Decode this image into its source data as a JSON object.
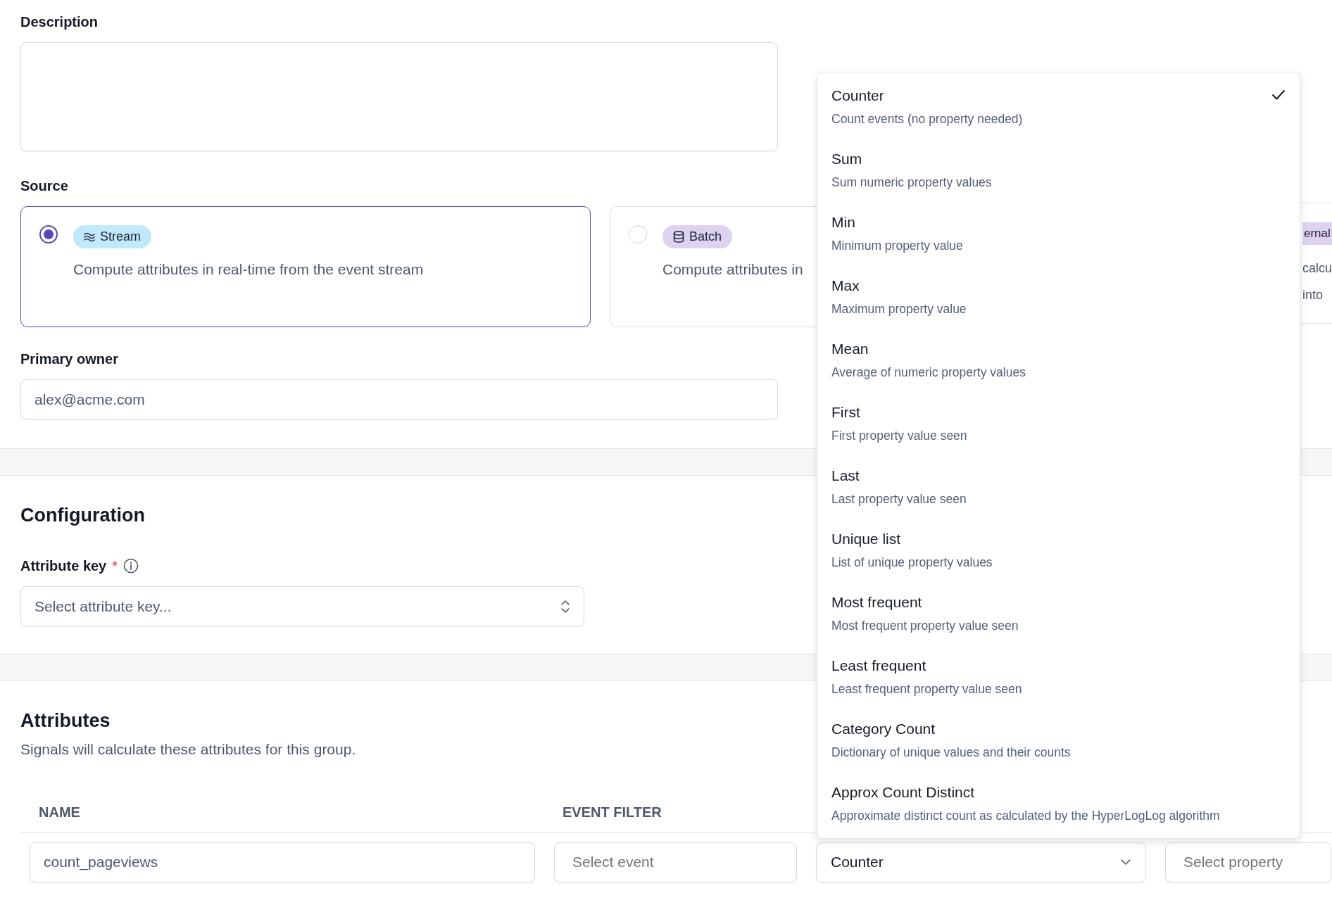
{
  "description": {
    "label": "Description"
  },
  "source": {
    "label": "Source",
    "options": [
      {
        "kind": "full",
        "badge": "Stream",
        "color": "#c1e8fb",
        "selected": true,
        "description": [
          "Compute attributes in real-time from the event stream"
        ]
      },
      {
        "kind": "full",
        "badge": "Batch",
        "color": "#ddd3f0",
        "selected": false,
        "description": [
          "Compute attributes in"
        ]
      },
      {
        "kind": "clipped",
        "badge": "ernal",
        "color": "#ddd3f0",
        "description": [
          "calcu",
          "into"
        ]
      }
    ]
  },
  "primary_owner": {
    "label": "Primary owner",
    "value": "alex@acme.com"
  },
  "configuration": {
    "heading": "Configuration",
    "attribute_key": {
      "label": "Attribute key",
      "required": "*",
      "placeholder": "Select attribute key..."
    }
  },
  "attributes": {
    "heading": "Attributes",
    "subtitle": "Signals will calculate these attributes for this group.",
    "columns": [
      "NAME",
      "EVENT FILTER"
    ],
    "rows": [
      {
        "name": "count_pageviews",
        "event_filter_placeholder": "Select event",
        "aggregation": "Counter",
        "property_placeholder": "Select property"
      }
    ]
  },
  "aggregation_menu": {
    "options": [
      {
        "label": "Counter",
        "description": "Count events (no property needed)",
        "selected": true
      },
      {
        "label": "Sum",
        "description": "Sum numeric property values",
        "selected": false
      },
      {
        "label": "Min",
        "description": "Minimum property value",
        "selected": false
      },
      {
        "label": "Max",
        "description": "Maximum property value",
        "selected": false
      },
      {
        "label": "Mean",
        "description": "Average of numeric property values",
        "selected": false
      },
      {
        "label": "First",
        "description": "First property value seen",
        "selected": false
      },
      {
        "label": "Last",
        "description": "Last property value seen",
        "selected": false
      },
      {
        "label": "Unique list",
        "description": "List of unique property values",
        "selected": false
      },
      {
        "label": "Most frequent",
        "description": "Most frequent property value seen",
        "selected": false
      },
      {
        "label": "Least frequent",
        "description": "Least frequent property value seen",
        "selected": false
      },
      {
        "label": "Category Count",
        "description": "Dictionary of unique values and their counts",
        "selected": false
      },
      {
        "label": "Approx Count Distinct",
        "description": "Approximate distinct count as calculated by the HyperLogLog algorithm",
        "selected": false
      }
    ]
  }
}
